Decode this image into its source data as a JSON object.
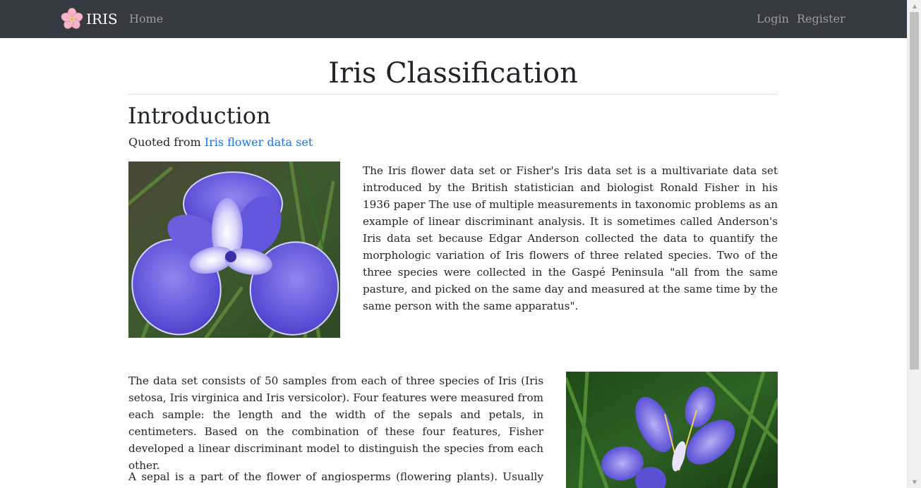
{
  "navbar": {
    "brand": "IRIS",
    "links": {
      "home": "Home",
      "login": "Login",
      "register": "Register"
    }
  },
  "main": {
    "title": "Iris Classification",
    "intro_heading": "Introduction",
    "quote_prefix": "Quoted from ",
    "quote_link": "Iris flower data set",
    "paragraphs": [
      "The Iris flower data set or Fisher's Iris data set is a multivariate data set introduced by the British statistician and biologist Ronald Fisher in his 1936 paper The use of multiple measurements in taxonomic problems as an example of linear discriminant analysis. It is sometimes called Anderson's Iris data set because Edgar Anderson collected the data to quantify the morphologic variation of Iris flowers of three related species. Two of the three species were collected in the Gaspé Peninsula \"all from the same pasture, and picked on the same day and measured at the same time by the same person with the same apparatus\".",
      "The data set consists of 50 samples from each of three species of Iris (Iris setosa, Iris virginica and Iris versicolor). Four features were measured from each sample: the length and the width of the sepals and petals, in centimeters. Based on the combination of these four features, Fisher developed a linear discriminant model to distinguish the species from each other.",
      "A sepal is a part of the flower of angiosperms (flowering plants). Usually green,"
    ]
  },
  "colors": {
    "navbar_bg": "#343a40",
    "link": "#1a73e8",
    "text": "#212529",
    "iris_petal": "#6a5acd"
  }
}
